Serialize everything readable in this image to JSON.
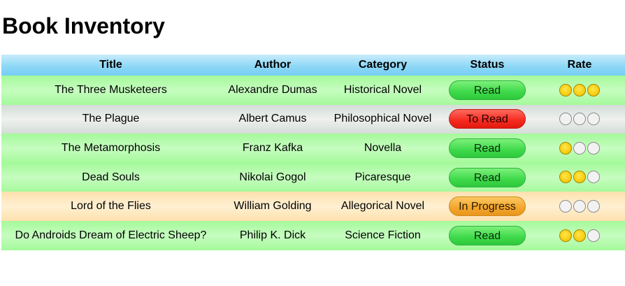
{
  "page": {
    "title": "Book Inventory"
  },
  "table": {
    "headers": {
      "title": "Title",
      "author": "Author",
      "category": "Category",
      "status": "Status",
      "rate": "Rate"
    },
    "rows": [
      {
        "title": "The Three Musketeers",
        "author": "Alexandre Dumas",
        "category": "Historical Novel",
        "status": "Read",
        "status_kind": "read",
        "rating": 3,
        "rating_max": 3
      },
      {
        "title": "The Plague",
        "author": "Albert Camus",
        "category": "Philosophical Novel",
        "status": "To Read",
        "status_kind": "toread",
        "rating": 0,
        "rating_max": 3
      },
      {
        "title": "The Metamorphosis",
        "author": "Franz Kafka",
        "category": "Novella",
        "status": "Read",
        "status_kind": "read",
        "rating": 1,
        "rating_max": 3
      },
      {
        "title": "Dead Souls",
        "author": "Nikolai Gogol",
        "category": "Picaresque",
        "status": "Read",
        "status_kind": "read",
        "rating": 2,
        "rating_max": 3
      },
      {
        "title": "Lord of the Flies",
        "author": "William Golding",
        "category": "Allegorical Novel",
        "status": "In Progress",
        "status_kind": "progress",
        "rating": 0,
        "rating_max": 3
      },
      {
        "title": "Do Androids Dream of Electric Sheep?",
        "author": "Philip K. Dick",
        "category": "Science Fiction",
        "status": "Read",
        "status_kind": "read",
        "rating": 2,
        "rating_max": 3
      }
    ]
  },
  "colors": {
    "header": "#8fd8f6",
    "row_read": "#b5fbae",
    "row_toread": "#e1e6e2",
    "row_progress": "#fee8bf",
    "pill_read": "#3ed94a",
    "pill_toread": "#f52a1f",
    "pill_progress": "#f3a52a",
    "star_on": "#f9cd12",
    "star_off": "#f2f2f2"
  }
}
